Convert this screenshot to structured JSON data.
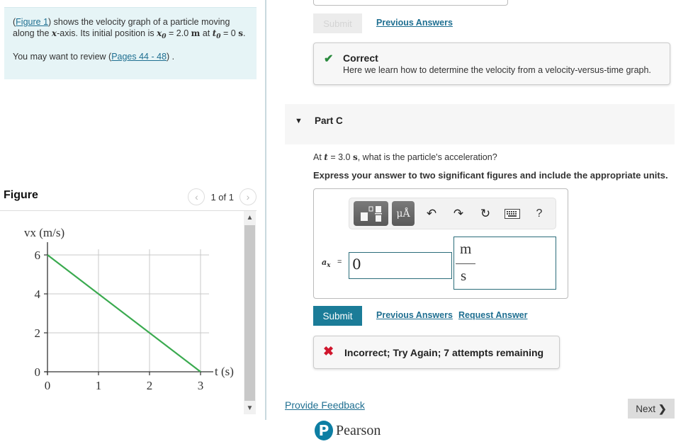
{
  "intro": {
    "figure_link": "Figure 1",
    "text_1": ") shows the velocity graph of a particle moving along the ",
    "x_var": "x",
    "text_2": "-axis. Its initial position is ",
    "x0_var": "x",
    "x0_sub": "0",
    "x0_eq": " = 2.0 ",
    "x0_unit": "m",
    "text_3": " at ",
    "t0_var": "t",
    "t0_sub": "0",
    "t0_eq": " = 0 ",
    "t0_unit": "s",
    "text_4": ".",
    "review_prefix": "You may want to review (",
    "review_link": "Pages 44 - 48",
    "review_suffix": ") ."
  },
  "figure_panel": {
    "title": "Figure",
    "pager_text": "1 of 1",
    "prev_icon": "chevron-left-icon",
    "next_icon": "chevron-right-icon"
  },
  "chart_data": {
    "type": "line",
    "title": "",
    "xlabel": "t (s)",
    "ylabel": "vx (m/s)",
    "x_ticks": [
      0,
      1,
      2,
      3
    ],
    "y_ticks": [
      0,
      2,
      4,
      6
    ],
    "xlim": [
      0,
      3
    ],
    "ylim": [
      0,
      6
    ],
    "grid": true,
    "series": [
      {
        "name": "velocity",
        "color": "#3aaa4f",
        "x": [
          0,
          3
        ],
        "y": [
          6,
          0
        ]
      }
    ]
  },
  "part_b_tail": {
    "submit_label": "Submit",
    "previous_answers": "Previous Answers",
    "feedback_title": "Correct",
    "feedback_message": "Here we learn how to determine the velocity from a velocity-versus-time graph."
  },
  "part_c": {
    "title": "Part C",
    "question_prefix": "At ",
    "question_var": "t",
    "question_eq": " = 3.0 ",
    "question_unit": "s",
    "question_suffix": ", what is the particle's acceleration?",
    "instruction": "Express your answer to two significant figures and include the appropriate units.",
    "toolbar": {
      "template_icon": "templates-icon",
      "units_label": "μÅ",
      "undo_icon": "undo-icon",
      "redo_icon": "redo-icon",
      "reset_icon": "reset-icon",
      "keyboard_icon": "keyboard-icon",
      "help_label": "?"
    },
    "variable_label": "a",
    "variable_sub": "x",
    "equals": "=",
    "value": "0",
    "unit_numerator": "m",
    "unit_denominator": "s",
    "submit_label": "Submit",
    "previous_answers": "Previous Answers",
    "request_answer": "Request Answer",
    "feedback_message": "Incorrect; Try Again; 7 attempts remaining"
  },
  "footer": {
    "provide_feedback": "Provide Feedback",
    "next_label": "Next",
    "brand": "Pearson",
    "brand_mark": "P"
  },
  "colors": {
    "accent": "#1b7c98",
    "correct": "#2a8a3e",
    "incorrect": "#d0162d",
    "intro_bg": "#e6f4f6",
    "line": "#3aaa4f"
  }
}
